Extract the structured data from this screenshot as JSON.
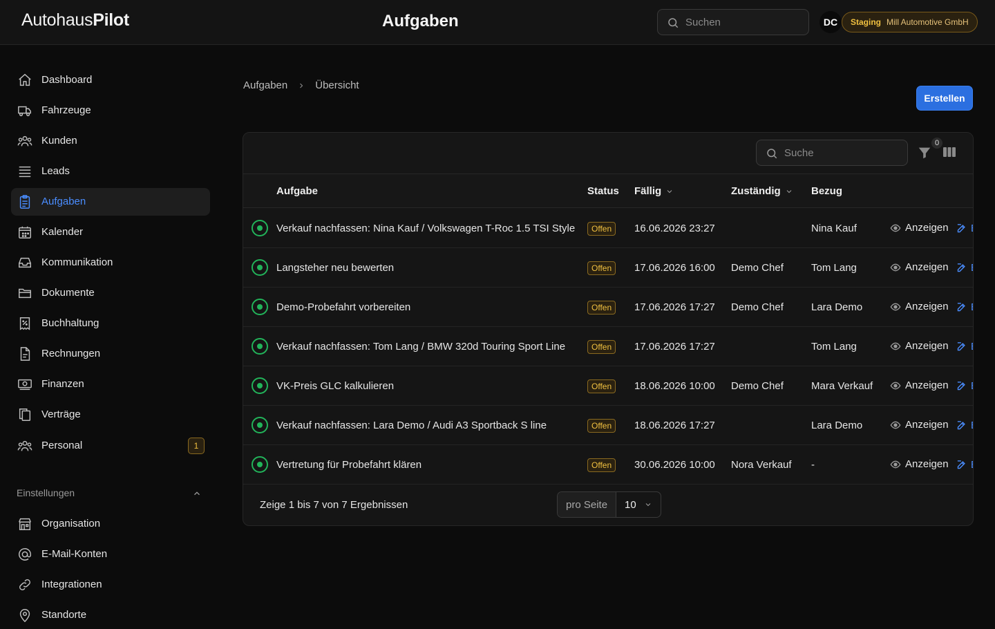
{
  "app": {
    "logo_light": "Autohaus",
    "logo_bold": "Pilot",
    "page_title": "Aufgaben",
    "search_placeholder": "Suchen",
    "avatar_initials": "DC",
    "environment": "Staging",
    "organization": "Mill Automotive GmbH"
  },
  "sidebar": {
    "items": [
      {
        "label": "Dashboard",
        "icon": "home-icon"
      },
      {
        "label": "Fahrzeuge",
        "icon": "truck-icon"
      },
      {
        "label": "Kunden",
        "icon": "users-icon"
      },
      {
        "label": "Leads",
        "icon": "list-icon"
      },
      {
        "label": "Aufgaben",
        "icon": "clipboard-icon",
        "active": true
      },
      {
        "label": "Kalender",
        "icon": "calendar-icon"
      },
      {
        "label": "Kommunikation",
        "icon": "inbox-icon"
      },
      {
        "label": "Dokumente",
        "icon": "folder-icon"
      },
      {
        "label": "Buchhaltung",
        "icon": "receipt-icon"
      },
      {
        "label": "Rechnungen",
        "icon": "document-icon"
      },
      {
        "label": "Finanzen",
        "icon": "banknote-icon"
      },
      {
        "label": "Verträge",
        "icon": "copy-icon"
      },
      {
        "label": "Personal",
        "icon": "team-icon",
        "badge": "1"
      }
    ],
    "settings_label": "Einstellungen",
    "settings_items": [
      {
        "label": "Organisation",
        "icon": "building-icon"
      },
      {
        "label": "E-Mail-Konten",
        "icon": "at-icon"
      },
      {
        "label": "Integrationen",
        "icon": "link-icon"
      },
      {
        "label": "Standorte",
        "icon": "map-pin-icon"
      }
    ]
  },
  "breadcrumb": {
    "root": "Aufgaben",
    "current": "Übersicht"
  },
  "create_button": "Erstellen",
  "table": {
    "search_placeholder": "Suche",
    "filter_count": "0",
    "columns": {
      "task": "Aufgabe",
      "status": "Status",
      "due": "Fällig",
      "assignee": "Zuständig",
      "reference": "Bezug"
    },
    "view_label": "Anzeigen",
    "edit_label": "B",
    "rows": [
      {
        "task": "Verkauf nachfassen: Nina Kauf / Volkswagen T-Roc 1.5 TSI Style",
        "status": "Offen",
        "due": "16.06.2026 23:27",
        "assignee": "",
        "reference": "Nina Kauf"
      },
      {
        "task": "Langsteher neu bewerten",
        "status": "Offen",
        "due": "17.06.2026 16:00",
        "assignee": "Demo Chef",
        "reference": "Tom Lang"
      },
      {
        "task": "Demo-Probefahrt vorbereiten",
        "status": "Offen",
        "due": "17.06.2026 17:27",
        "assignee": "Demo Chef",
        "reference": "Lara Demo"
      },
      {
        "task": "Verkauf nachfassen: Tom Lang / BMW 320d Touring Sport Line",
        "status": "Offen",
        "due": "17.06.2026 17:27",
        "assignee": "",
        "reference": "Tom Lang"
      },
      {
        "task": "VK-Preis GLC kalkulieren",
        "status": "Offen",
        "due": "18.06.2026 10:00",
        "assignee": "Demo Chef",
        "reference": "Mara Verkauf"
      },
      {
        "task": "Verkauf nachfassen: Lara Demo / Audi A3 Sportback S line",
        "status": "Offen",
        "due": "18.06.2026 17:27",
        "assignee": "",
        "reference": "Lara Demo"
      },
      {
        "task": "Vertretung für Probefahrt klären",
        "status": "Offen",
        "due": "30.06.2026 10:00",
        "assignee": "Nora Verkauf",
        "reference": "-"
      }
    ],
    "summary": "Zeige 1 bis 7 von 7 Ergebnissen",
    "per_page_label": "pro Seite",
    "per_page_value": "10"
  },
  "colors": {
    "accent": "#4a8dff",
    "primary_button": "#2b6fe0",
    "status_open": "#f0c040",
    "task_done_ring": "#22b45a"
  }
}
